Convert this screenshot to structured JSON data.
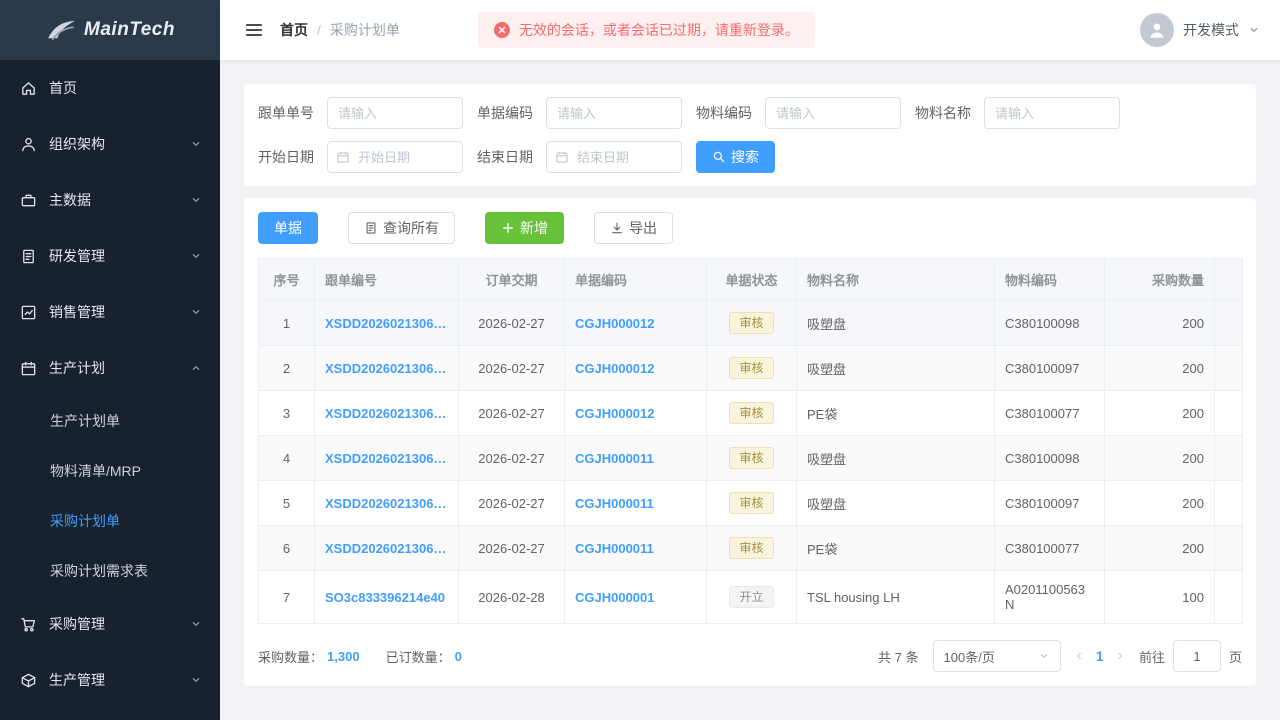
{
  "sidebar": {
    "logo_text": "MainTech",
    "items": [
      {
        "label": "首页"
      },
      {
        "label": "组织架构"
      },
      {
        "label": "主数据"
      },
      {
        "label": "研发管理"
      },
      {
        "label": "销售管理"
      },
      {
        "label": "生产计划",
        "children": [
          {
            "label": "生产计划单"
          },
          {
            "label": "物料清单/MRP"
          },
          {
            "label": "采购计划单",
            "active": true
          },
          {
            "label": "采购计划需求表"
          }
        ]
      },
      {
        "label": "采购管理"
      },
      {
        "label": "生产管理"
      }
    ]
  },
  "header": {
    "breadcrumb": [
      "首页",
      "采购计划单"
    ],
    "breadcrumb_separator": "/",
    "alert_message": "无效的会话，或者会话已过期，请重新登录。",
    "user_mode": "开发模式"
  },
  "filters": {
    "text_fields": [
      {
        "label": "跟单单号",
        "placeholder": "请输入"
      },
      {
        "label": "单据编码",
        "placeholder": "请输入"
      },
      {
        "label": "物料编码",
        "placeholder": "请输入"
      },
      {
        "label": "物料名称",
        "placeholder": "请输入"
      }
    ],
    "date_fields": [
      {
        "label": "开始日期",
        "placeholder": "开始日期"
      },
      {
        "label": "结束日期",
        "placeholder": "结束日期"
      }
    ],
    "search_button": "搜索"
  },
  "toolbar": {
    "doc_button": "单据",
    "query_all_button": "查询所有",
    "add_button": "新增",
    "export_button": "导出"
  },
  "table": {
    "columns": [
      "序号",
      "跟单编号",
      "订单交期",
      "单据编码",
      "单据状态",
      "物料名称",
      "物料编码",
      "采购数量"
    ],
    "statuses": {
      "审核": {
        "bg": "#faf4dc",
        "text": "#a3913f",
        "border": "#ece0b4"
      },
      "开立": {
        "bg": "#f4f4f5",
        "text": "#909399",
        "border": "#e9e9eb"
      }
    },
    "rows": [
      {
        "seq": "1",
        "order_no": "XSDD2026021306…",
        "delivery_date": "2026-02-27",
        "doc_no": "CGJH000012",
        "status": "审核",
        "material_name": "吸塑盘",
        "material_code": "C380100098",
        "qty": "200"
      },
      {
        "seq": "2",
        "order_no": "XSDD2026021306…",
        "delivery_date": "2026-02-27",
        "doc_no": "CGJH000012",
        "status": "审核",
        "material_name": "吸塑盘",
        "material_code": "C380100097",
        "qty": "200"
      },
      {
        "seq": "3",
        "order_no": "XSDD2026021306…",
        "delivery_date": "2026-02-27",
        "doc_no": "CGJH000012",
        "status": "审核",
        "material_name": "PE袋",
        "material_code": "C380100077",
        "qty": "200"
      },
      {
        "seq": "4",
        "order_no": "XSDD2026021306…",
        "delivery_date": "2026-02-27",
        "doc_no": "CGJH000011",
        "status": "审核",
        "material_name": "吸塑盘",
        "material_code": "C380100098",
        "qty": "200"
      },
      {
        "seq": "5",
        "order_no": "XSDD2026021306…",
        "delivery_date": "2026-02-27",
        "doc_no": "CGJH000011",
        "status": "审核",
        "material_name": "吸塑盘",
        "material_code": "C380100097",
        "qty": "200"
      },
      {
        "seq": "6",
        "order_no": "XSDD2026021306…",
        "delivery_date": "2026-02-27",
        "doc_no": "CGJH000011",
        "status": "审核",
        "material_name": "PE袋",
        "material_code": "C380100077",
        "qty": "200"
      },
      {
        "seq": "7",
        "order_no": "SO3c833396214e40",
        "delivery_date": "2026-02-28",
        "doc_no": "CGJH000001",
        "status": "开立",
        "material_name": "TSL housing LH",
        "material_code": "A0201100563N",
        "qty": "100"
      }
    ]
  },
  "footer": {
    "purchase_qty_label": "采购数量：",
    "purchase_qty_value": "1,300",
    "ordered_qty_label": "已订数量：",
    "ordered_qty_value": "0",
    "total_text": "共 7 条",
    "page_size": "100条/页",
    "prev_arrow": "‹",
    "next_arrow": "›",
    "current_page": "1",
    "goto_label": "前往",
    "goto_value": "1",
    "goto_suffix": "页"
  },
  "colors": {
    "primary": "#409eff",
    "success": "#67c23a",
    "danger": "#f56c6c",
    "sidebar_bg": "#18222e",
    "content_bg": "#f0f2f5"
  }
}
